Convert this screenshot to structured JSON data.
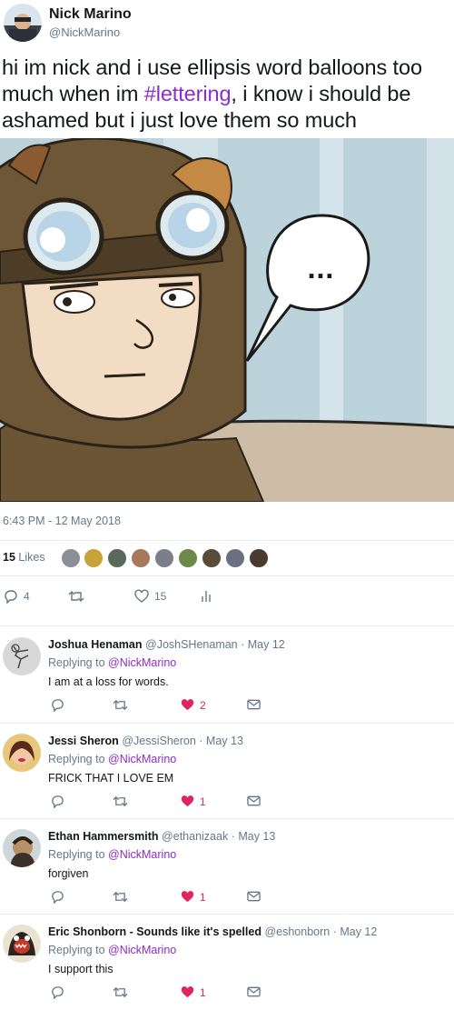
{
  "author": {
    "name": "Nick Marino",
    "handle": "@NickMarino"
  },
  "tweet": {
    "text_before": "hi im nick and i use ellipsis word balloons too much when im ",
    "hashtag": "#lettering",
    "text_after": ", i know i should be ashamed but i just love them so much",
    "timestamp": "6:43 PM - 12 May 2018",
    "media_balloon_text": "..."
  },
  "likes": {
    "count": "15",
    "label": "Likes"
  },
  "actions": {
    "replies": "4",
    "retweets": "",
    "likes": "15"
  },
  "replies": [
    {
      "name": "Joshua Henaman",
      "handle": "@JoshSHenaman",
      "date": "· May 12",
      "replying_label": "Replying to",
      "replying_to": "@NickMarino",
      "text": "I am at a loss for words.",
      "likes": "2"
    },
    {
      "name": "Jessi Sheron",
      "handle": "@JessiSheron",
      "date": "· May 13",
      "replying_label": "Replying to",
      "replying_to": "@NickMarino",
      "text": "FRICK THAT I LOVE EM",
      "likes": "1"
    },
    {
      "name": "Ethan Hammersmith",
      "handle": "@ethanizaak",
      "date": "· May 13",
      "replying_label": "Replying to",
      "replying_to": "@NickMarino",
      "text": "forgiven",
      "likes": "1"
    },
    {
      "name": "Eric Shonborn - Sounds like it's spelled",
      "handle": "@eshonborn",
      "date": "· May 12",
      "replying_label": "Replying to",
      "replying_to": "@NickMarino",
      "text": "I support this",
      "likes": "1"
    }
  ],
  "colors": {
    "hashtag": "#8b2dc9",
    "secondary_text": "#657786",
    "like_active": "#e0245e",
    "divider": "#e6ecf0"
  },
  "icons": {
    "reply": "reply-icon",
    "retweet": "retweet-icon",
    "like": "heart-icon",
    "analytics": "analytics-icon",
    "dm": "envelope-icon"
  }
}
